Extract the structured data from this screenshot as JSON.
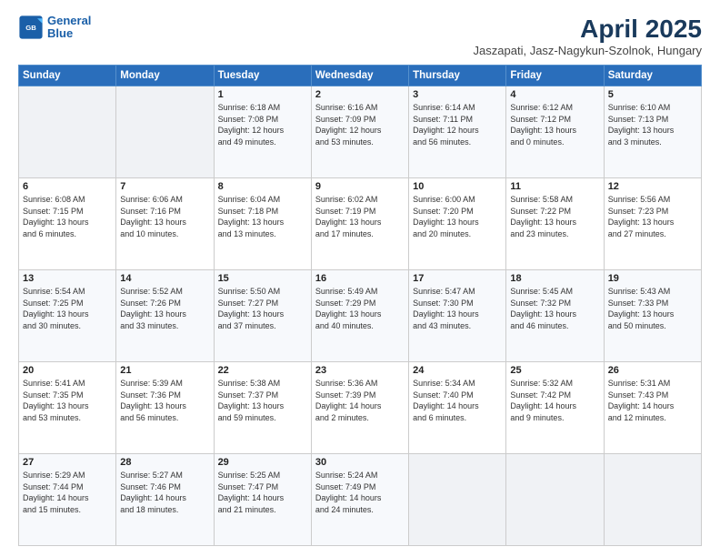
{
  "logo": {
    "line1": "General",
    "line2": "Blue"
  },
  "title": "April 2025",
  "subtitle": "Jaszapati, Jasz-Nagykun-Szolnok, Hungary",
  "headers": [
    "Sunday",
    "Monday",
    "Tuesday",
    "Wednesday",
    "Thursday",
    "Friday",
    "Saturday"
  ],
  "weeks": [
    [
      {
        "day": "",
        "info": ""
      },
      {
        "day": "",
        "info": ""
      },
      {
        "day": "1",
        "info": "Sunrise: 6:18 AM\nSunset: 7:08 PM\nDaylight: 12 hours\nand 49 minutes."
      },
      {
        "day": "2",
        "info": "Sunrise: 6:16 AM\nSunset: 7:09 PM\nDaylight: 12 hours\nand 53 minutes."
      },
      {
        "day": "3",
        "info": "Sunrise: 6:14 AM\nSunset: 7:11 PM\nDaylight: 12 hours\nand 56 minutes."
      },
      {
        "day": "4",
        "info": "Sunrise: 6:12 AM\nSunset: 7:12 PM\nDaylight: 13 hours\nand 0 minutes."
      },
      {
        "day": "5",
        "info": "Sunrise: 6:10 AM\nSunset: 7:13 PM\nDaylight: 13 hours\nand 3 minutes."
      }
    ],
    [
      {
        "day": "6",
        "info": "Sunrise: 6:08 AM\nSunset: 7:15 PM\nDaylight: 13 hours\nand 6 minutes."
      },
      {
        "day": "7",
        "info": "Sunrise: 6:06 AM\nSunset: 7:16 PM\nDaylight: 13 hours\nand 10 minutes."
      },
      {
        "day": "8",
        "info": "Sunrise: 6:04 AM\nSunset: 7:18 PM\nDaylight: 13 hours\nand 13 minutes."
      },
      {
        "day": "9",
        "info": "Sunrise: 6:02 AM\nSunset: 7:19 PM\nDaylight: 13 hours\nand 17 minutes."
      },
      {
        "day": "10",
        "info": "Sunrise: 6:00 AM\nSunset: 7:20 PM\nDaylight: 13 hours\nand 20 minutes."
      },
      {
        "day": "11",
        "info": "Sunrise: 5:58 AM\nSunset: 7:22 PM\nDaylight: 13 hours\nand 23 minutes."
      },
      {
        "day": "12",
        "info": "Sunrise: 5:56 AM\nSunset: 7:23 PM\nDaylight: 13 hours\nand 27 minutes."
      }
    ],
    [
      {
        "day": "13",
        "info": "Sunrise: 5:54 AM\nSunset: 7:25 PM\nDaylight: 13 hours\nand 30 minutes."
      },
      {
        "day": "14",
        "info": "Sunrise: 5:52 AM\nSunset: 7:26 PM\nDaylight: 13 hours\nand 33 minutes."
      },
      {
        "day": "15",
        "info": "Sunrise: 5:50 AM\nSunset: 7:27 PM\nDaylight: 13 hours\nand 37 minutes."
      },
      {
        "day": "16",
        "info": "Sunrise: 5:49 AM\nSunset: 7:29 PM\nDaylight: 13 hours\nand 40 minutes."
      },
      {
        "day": "17",
        "info": "Sunrise: 5:47 AM\nSunset: 7:30 PM\nDaylight: 13 hours\nand 43 minutes."
      },
      {
        "day": "18",
        "info": "Sunrise: 5:45 AM\nSunset: 7:32 PM\nDaylight: 13 hours\nand 46 minutes."
      },
      {
        "day": "19",
        "info": "Sunrise: 5:43 AM\nSunset: 7:33 PM\nDaylight: 13 hours\nand 50 minutes."
      }
    ],
    [
      {
        "day": "20",
        "info": "Sunrise: 5:41 AM\nSunset: 7:35 PM\nDaylight: 13 hours\nand 53 minutes."
      },
      {
        "day": "21",
        "info": "Sunrise: 5:39 AM\nSunset: 7:36 PM\nDaylight: 13 hours\nand 56 minutes."
      },
      {
        "day": "22",
        "info": "Sunrise: 5:38 AM\nSunset: 7:37 PM\nDaylight: 13 hours\nand 59 minutes."
      },
      {
        "day": "23",
        "info": "Sunrise: 5:36 AM\nSunset: 7:39 PM\nDaylight: 14 hours\nand 2 minutes."
      },
      {
        "day": "24",
        "info": "Sunrise: 5:34 AM\nSunset: 7:40 PM\nDaylight: 14 hours\nand 6 minutes."
      },
      {
        "day": "25",
        "info": "Sunrise: 5:32 AM\nSunset: 7:42 PM\nDaylight: 14 hours\nand 9 minutes."
      },
      {
        "day": "26",
        "info": "Sunrise: 5:31 AM\nSunset: 7:43 PM\nDaylight: 14 hours\nand 12 minutes."
      }
    ],
    [
      {
        "day": "27",
        "info": "Sunrise: 5:29 AM\nSunset: 7:44 PM\nDaylight: 14 hours\nand 15 minutes."
      },
      {
        "day": "28",
        "info": "Sunrise: 5:27 AM\nSunset: 7:46 PM\nDaylight: 14 hours\nand 18 minutes."
      },
      {
        "day": "29",
        "info": "Sunrise: 5:25 AM\nSunset: 7:47 PM\nDaylight: 14 hours\nand 21 minutes."
      },
      {
        "day": "30",
        "info": "Sunrise: 5:24 AM\nSunset: 7:49 PM\nDaylight: 14 hours\nand 24 minutes."
      },
      {
        "day": "",
        "info": ""
      },
      {
        "day": "",
        "info": ""
      },
      {
        "day": "",
        "info": ""
      }
    ]
  ]
}
